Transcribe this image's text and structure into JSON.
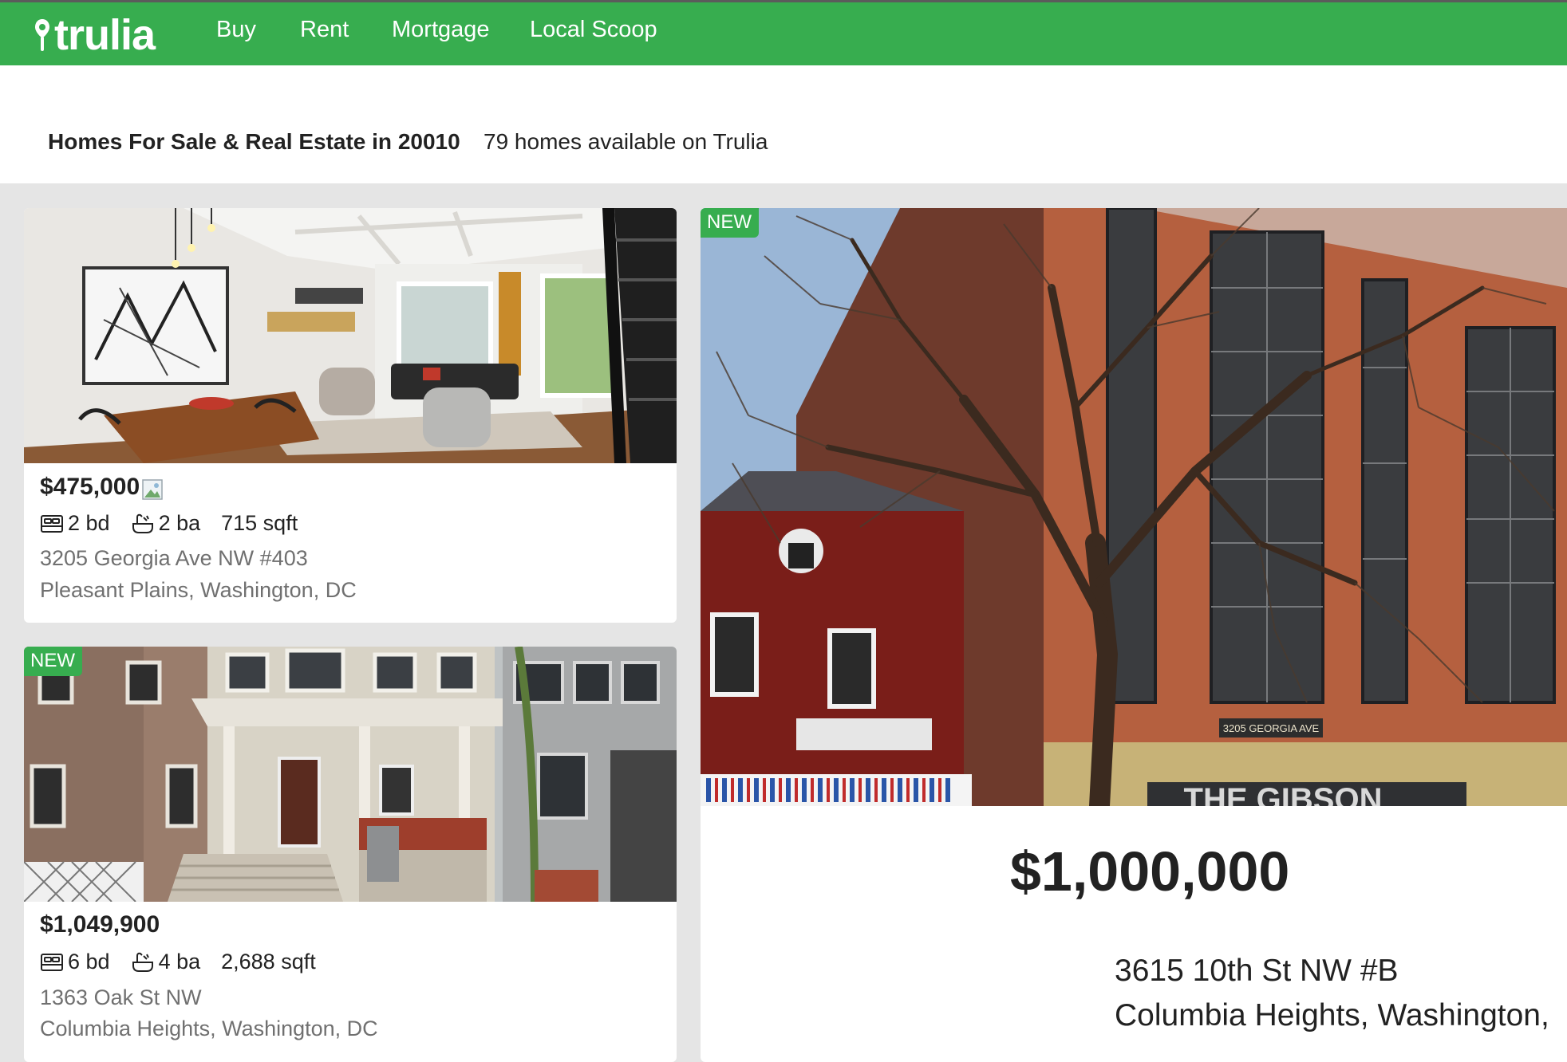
{
  "header": {
    "logo_text": "trulia",
    "nav": [
      "Buy",
      "Rent",
      "Mortgage",
      "Local Scoop"
    ]
  },
  "search": {
    "title": "Homes For Sale & Real Estate in 20010",
    "count": "79 homes available on Trulia"
  },
  "listings": [
    {
      "badge": "",
      "price": "$475,000",
      "beds": "2 bd",
      "baths": "2 ba",
      "sqft": "715 sqft",
      "street": "3205 Georgia Ave NW #403",
      "locality": "Pleasant Plains, Washington, DC"
    },
    {
      "badge": "NEW",
      "price": "$1,049,900",
      "beds": "6 bd",
      "baths": "4 ba",
      "sqft": "2,688 sqft",
      "street": "1363 Oak St NW",
      "locality": "Columbia Heights, Washington, DC"
    },
    {
      "badge": "NEW",
      "price": "$1,000,000",
      "street": "3615 10th St NW #B",
      "locality": "Columbia Heights, Washington,",
      "sign_text": "3205 GEORGIA AVE",
      "facade_text": "THE GIBSON"
    }
  ],
  "colors": {
    "brand_green": "#37ad4f",
    "nav_border": "#5b5b5b",
    "muted_text": "#707070"
  },
  "icons": [
    "location-pin-icon",
    "bed-icon",
    "bath-icon",
    "broken-image-icon"
  ]
}
